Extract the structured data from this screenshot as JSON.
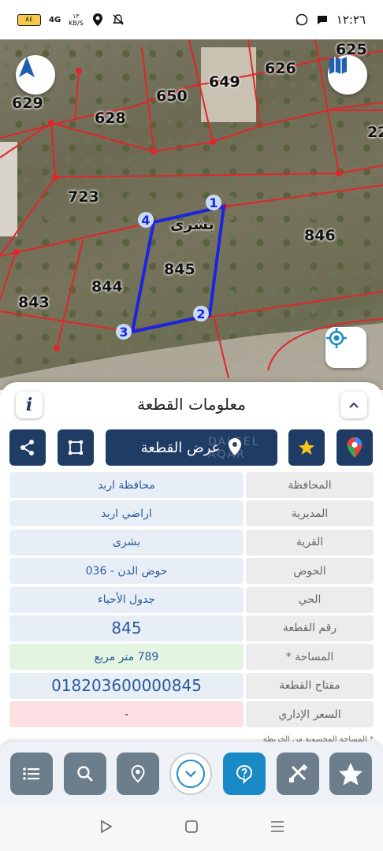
{
  "status_bar": {
    "time": "١٢:٢٦",
    "battery": "٨٤",
    "network_speed_value": "١٣",
    "network_speed_unit": "KB/S",
    "signal": "4G",
    "icons": [
      "whatsapp-icon",
      "chat-icon",
      "mute-icon",
      "location-icon",
      "signal-icon",
      "battery-icon"
    ]
  },
  "map": {
    "parcel_labels": [
      "625",
      "626",
      "649",
      "650",
      "629",
      "628",
      "723",
      "846",
      "844",
      "843",
      "845",
      "22"
    ],
    "village_label": "بشرى",
    "vertices": [
      "1",
      "2",
      "3",
      "4"
    ],
    "colors": {
      "parcel_line": "#e0262a",
      "selected_parcel": "#1b24e0",
      "vertex_fill": "#c8dbf5"
    }
  },
  "panel": {
    "title": "معلومات القطعة",
    "info_label": "i",
    "show_parcel_label": "عرض القطعة",
    "watermark": "DALEEL AQAR",
    "rows": [
      {
        "label": "المحافظة",
        "value": "محافظة اربد"
      },
      {
        "label": "المديرية",
        "value": "اراضي اربد"
      },
      {
        "label": "القرية",
        "value": "بشرى"
      },
      {
        "label": "الحوض",
        "value": "حوض الدن - 036"
      },
      {
        "label": "الحي",
        "value": "جدول الأحياء"
      },
      {
        "label": "رقم القطعة",
        "value": "845"
      },
      {
        "label": "المساحة *",
        "value": "789  متر مربع"
      },
      {
        "label": "مفتاح القطعة",
        "value": "018203600000845"
      },
      {
        "label": "السعر الإداري",
        "value": "-"
      }
    ],
    "footnote": "* المساحة المحسوبة من الخريطة"
  },
  "toolbar": {
    "items": [
      "menu-icon",
      "search-icon",
      "location-pin-icon",
      "chevron-down-icon",
      "help-icon",
      "tools-icon",
      "star-icon"
    ]
  },
  "colors": {
    "primary": "#1f3c64",
    "accent": "#1a8ac6",
    "value_text": "#2a5a9c"
  }
}
